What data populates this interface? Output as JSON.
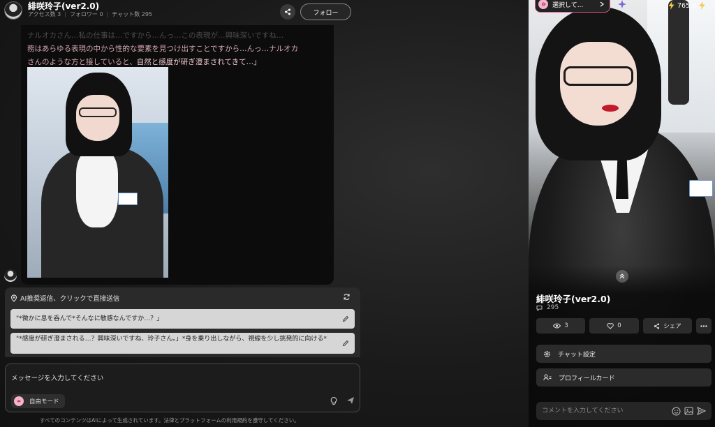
{
  "header": {
    "title": "緋咲玲子(ver2.0)",
    "access_label": "アクセス数 3",
    "follower_label": "フォロワー 0",
    "chat_label": "チャット数 295",
    "follow_label": "フォロー"
  },
  "message": {
    "lines": [
      "務はあらゆる表現の中から性的な要素を見つけ出すことですから…んっ…ナルオカ",
      "さんのような方と接していると、",
      "自然と感度が研ぎ澄まされてきて…」"
    ],
    "faded_line": "ナルオカさん…私の仕事は…ですから…んっ…この表現が…興味深いですね…"
  },
  "suggestions": {
    "header": "AI推奨返信、クリックで直接送信",
    "items": [
      "\"*微かに息を呑んで*そんなに敏感なんですか…？」",
      "\"*感度が研ぎ澄まされる…？興味深いですね、玲子さん。」*身を乗り出しながら、視線を少し挑発的に向ける*"
    ]
  },
  "input": {
    "placeholder": "メッセージを入力してください",
    "mode_label": "自由モード"
  },
  "disclaimer": "すべてのコンテンツはAIによって生成されています。法律とプラットフォームの利用規約を遵守してください。",
  "right_panel": {
    "select_label": "選択して...",
    "credit": "765.6",
    "name": "緋咲玲子(ver2.0)",
    "chat_count": "295",
    "views": "3",
    "likes": "0",
    "share_label": "シェア",
    "chat_settings": "チャット設定",
    "profile_card": "プロフィールカード",
    "comment_placeholder": "コメントを入力してください"
  },
  "colors": {
    "accent_pink": "#e0588a",
    "badge_pink": "#f4b5cc",
    "text_pink": "#d8a9b4"
  }
}
